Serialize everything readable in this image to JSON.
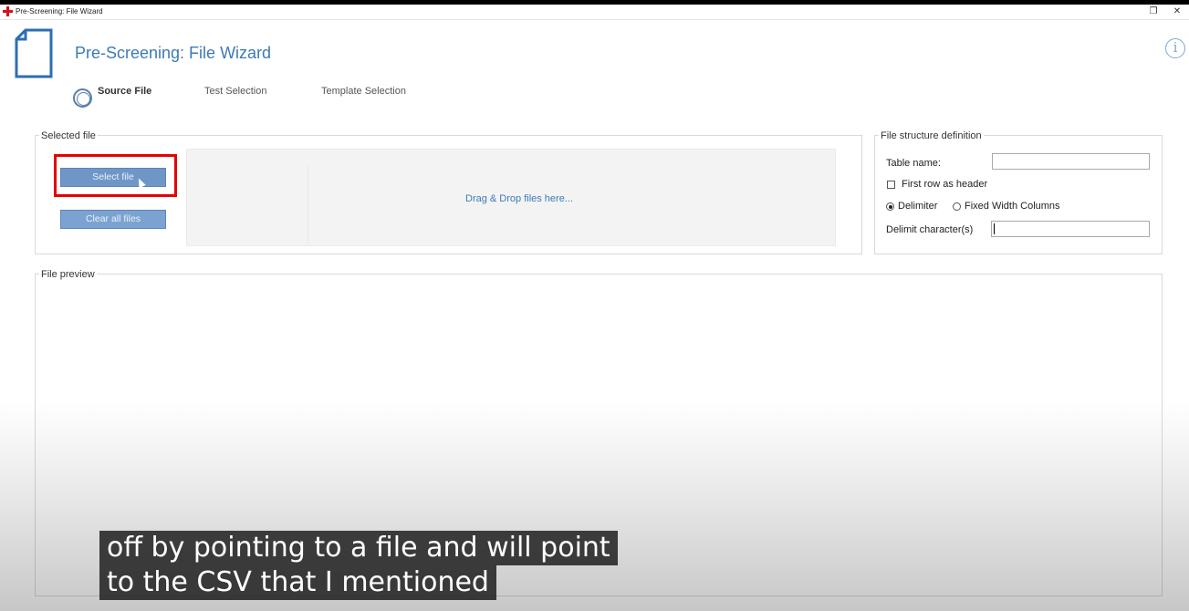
{
  "window": {
    "title": "Pre-Screening: File Wizard",
    "restore_glyph": "❐",
    "close_glyph": "✕"
  },
  "header": {
    "title": "Pre-Screening: File Wizard",
    "info_glyph": "i"
  },
  "steps": [
    {
      "label": "Source File",
      "active": true
    },
    {
      "label": "Test Selection",
      "active": false
    },
    {
      "label": "Template Selection",
      "active": false
    }
  ],
  "selected_file": {
    "legend": "Selected file",
    "select_label": "Select file",
    "clear_label": "Clear all files",
    "drop_text": "Drag & Drop files here..."
  },
  "structure": {
    "legend": "File structure definition",
    "table_name_label": "Table name:",
    "table_name_value": "",
    "first_row_label": "First row as header",
    "first_row_checked": false,
    "delimiter_label": "Delimiter",
    "fixed_width_label": "Fixed Width Columns",
    "delimiter_selected": true,
    "delim_chars_label": "Delimit character(s)",
    "delim_chars_value": ""
  },
  "preview": {
    "legend": "File preview"
  },
  "subtitles": {
    "line1": "off by pointing to a file and will point",
    "line2": "to the CSV that I mentioned"
  },
  "colors": {
    "accent": "#3d7ab8",
    "button": "#6f96c7",
    "highlight": "#e60000"
  }
}
